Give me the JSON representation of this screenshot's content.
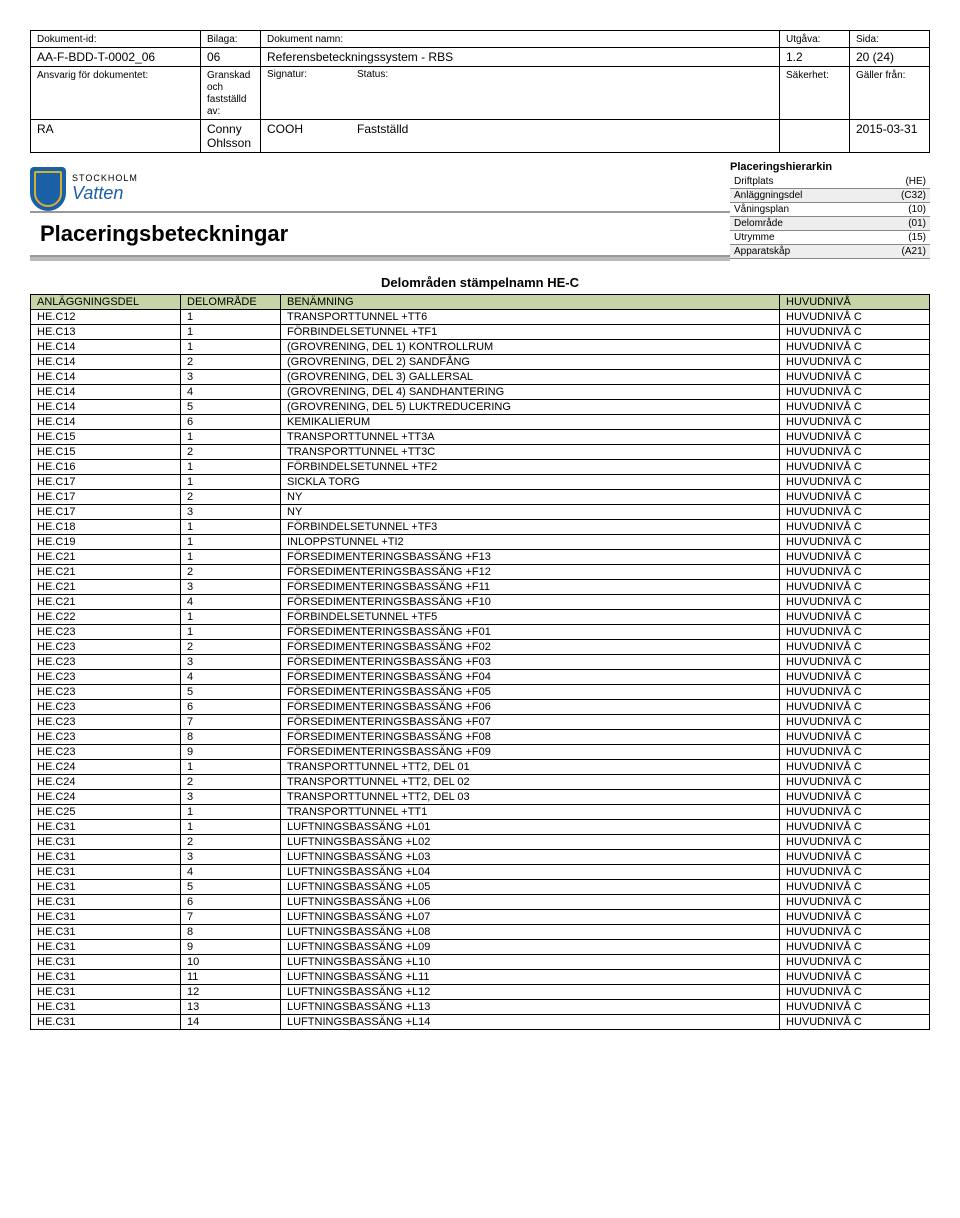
{
  "meta": {
    "labels": {
      "dok_id": "Dokument-id:",
      "bilaga": "Bilaga:",
      "dok_namn": "Dokument namn:",
      "utgava": "Utgåva:",
      "sida": "Sida:",
      "ansvarig": "Ansvarig för dokumentet:",
      "granskad": "Granskad och fastställd av:",
      "signatur": "Signatur:",
      "status": "Status:",
      "sakerhet": "Säkerhet:",
      "galler": "Gäller från:"
    },
    "values": {
      "dok_id": "AA-F-BDD-T-0002_06",
      "bilaga": "06",
      "dok_namn": "Referensbeteckningssystem - RBS",
      "utgava": "1.2",
      "sida": "20 (24)",
      "ansvarig": "RA",
      "granskad": "Conny Ohlsson",
      "signatur": "COOH",
      "status": "Fastställd",
      "sakerhet": "",
      "galler": "2015-03-31"
    }
  },
  "logo": {
    "line1": "STOCKHOLM",
    "line2": "Vatten"
  },
  "page_title": "Placeringsbeteckningar",
  "hierarchy": {
    "title": "Placeringshierarkin",
    "rows": [
      {
        "label": "Driftplats",
        "code": "(HE)"
      },
      {
        "label": "Anläggningsdel",
        "code": "(C32)"
      },
      {
        "label": "Våningsplan",
        "code": "(10)"
      },
      {
        "label": "Delområde",
        "code": "(01)"
      },
      {
        "label": "Utrymme",
        "code": "(15)"
      },
      {
        "label": "Apparatskåp",
        "code": "(A21)"
      }
    ]
  },
  "section_title": "Delområden stämpelnamn HE-C",
  "table": {
    "headers": {
      "a": "ANLÄGGNINGSDEL",
      "b": "DELOMRÅDE",
      "c": "BENÄMNING",
      "d": "HUVUDNIVÅ"
    },
    "rows": [
      {
        "a": "HE.C12",
        "b": "1",
        "c": "TRANSPORTTUNNEL +TT6",
        "d": "HUVUDNIVÅ C"
      },
      {
        "a": "HE.C13",
        "b": "1",
        "c": "FÖRBINDELSETUNNEL +TF1",
        "d": "HUVUDNIVÅ C"
      },
      {
        "a": "HE.C14",
        "b": "1",
        "c": "(GROVRENING, DEL 1) KONTROLLRUM",
        "d": "HUVUDNIVÅ C"
      },
      {
        "a": "HE.C14",
        "b": "2",
        "c": "(GROVRENING, DEL 2) SANDFÅNG",
        "d": "HUVUDNIVÅ C"
      },
      {
        "a": "HE.C14",
        "b": "3",
        "c": "(GROVRENING, DEL 3) GALLERSAL",
        "d": "HUVUDNIVÅ C"
      },
      {
        "a": "HE.C14",
        "b": "4",
        "c": "(GROVRENING, DEL 4) SANDHANTERING",
        "d": "HUVUDNIVÅ C"
      },
      {
        "a": "HE.C14",
        "b": "5",
        "c": "(GROVRENING, DEL 5) LUKTREDUCERING",
        "d": "HUVUDNIVÅ C"
      },
      {
        "a": "HE.C14",
        "b": "6",
        "c": "KEMIKALIERUM",
        "d": "HUVUDNIVÅ C"
      },
      {
        "a": "HE.C15",
        "b": "1",
        "c": "TRANSPORTTUNNEL +TT3A",
        "d": "HUVUDNIVÅ C"
      },
      {
        "a": "HE.C15",
        "b": "2",
        "c": "TRANSPORTTUNNEL +TT3C",
        "d": "HUVUDNIVÅ C"
      },
      {
        "a": "HE.C16",
        "b": "1",
        "c": "FÖRBINDELSETUNNEL +TF2",
        "d": "HUVUDNIVÅ C"
      },
      {
        "a": "HE.C17",
        "b": "1",
        "c": "SICKLA TORG",
        "d": "HUVUDNIVÅ C"
      },
      {
        "a": "HE.C17",
        "b": "2",
        "c": "NY",
        "d": "HUVUDNIVÅ C"
      },
      {
        "a": "HE.C17",
        "b": "3",
        "c": "NY",
        "d": "HUVUDNIVÅ C"
      },
      {
        "a": "HE.C18",
        "b": "1",
        "c": "FÖRBINDELSETUNNEL +TF3",
        "d": "HUVUDNIVÅ C"
      },
      {
        "a": "HE.C19",
        "b": "1",
        "c": "INLOPPSTUNNEL +TI2",
        "d": "HUVUDNIVÅ C"
      },
      {
        "a": "HE.C21",
        "b": "1",
        "c": "FÖRSEDIMENTERINGSBASSÄNG +F13",
        "d": "HUVUDNIVÅ C"
      },
      {
        "a": "HE.C21",
        "b": "2",
        "c": "FÖRSEDIMENTERINGSBASSÄNG +F12",
        "d": "HUVUDNIVÅ C"
      },
      {
        "a": "HE.C21",
        "b": "3",
        "c": "FÖRSEDIMENTERINGSBASSÄNG +F11",
        "d": "HUVUDNIVÅ C"
      },
      {
        "a": "HE.C21",
        "b": "4",
        "c": "FÖRSEDIMENTERINGSBASSÄNG +F10",
        "d": "HUVUDNIVÅ C"
      },
      {
        "a": "HE.C22",
        "b": "1",
        "c": "FÖRBINDELSETUNNEL +TF5",
        "d": "HUVUDNIVÅ C"
      },
      {
        "a": "HE.C23",
        "b": "1",
        "c": "FÖRSEDIMENTERINGSBASSÄNG +F01",
        "d": "HUVUDNIVÅ C"
      },
      {
        "a": "HE.C23",
        "b": "2",
        "c": "FÖRSEDIMENTERINGSBASSÄNG +F02",
        "d": "HUVUDNIVÅ C"
      },
      {
        "a": "HE.C23",
        "b": "3",
        "c": "FÖRSEDIMENTERINGSBASSÄNG +F03",
        "d": "HUVUDNIVÅ C"
      },
      {
        "a": "HE.C23",
        "b": "4",
        "c": "FÖRSEDIMENTERINGSBASSÄNG +F04",
        "d": "HUVUDNIVÅ C"
      },
      {
        "a": "HE.C23",
        "b": "5",
        "c": "FÖRSEDIMENTERINGSBASSÄNG +F05",
        "d": "HUVUDNIVÅ C"
      },
      {
        "a": "HE.C23",
        "b": "6",
        "c": "FÖRSEDIMENTERINGSBASSÄNG +F06",
        "d": "HUVUDNIVÅ C"
      },
      {
        "a": "HE.C23",
        "b": "7",
        "c": "FÖRSEDIMENTERINGSBASSÄNG +F07",
        "d": "HUVUDNIVÅ C"
      },
      {
        "a": "HE.C23",
        "b": "8",
        "c": "FÖRSEDIMENTERINGSBASSÄNG +F08",
        "d": "HUVUDNIVÅ C"
      },
      {
        "a": "HE.C23",
        "b": "9",
        "c": "FÖRSEDIMENTERINGSBASSÄNG +F09",
        "d": "HUVUDNIVÅ C"
      },
      {
        "a": "HE.C24",
        "b": "1",
        "c": "TRANSPORTTUNNEL +TT2, DEL 01",
        "d": "HUVUDNIVÅ C"
      },
      {
        "a": "HE.C24",
        "b": "2",
        "c": "TRANSPORTTUNNEL +TT2, DEL 02",
        "d": "HUVUDNIVÅ C"
      },
      {
        "a": "HE.C24",
        "b": "3",
        "c": "TRANSPORTTUNNEL +TT2, DEL 03",
        "d": "HUVUDNIVÅ C"
      },
      {
        "a": "HE.C25",
        "b": "1",
        "c": "TRANSPORTTUNNEL +TT1",
        "d": "HUVUDNIVÅ C"
      },
      {
        "a": "HE.C31",
        "b": "1",
        "c": "LUFTNINGSBASSÄNG +L01",
        "d": "HUVUDNIVÅ C"
      },
      {
        "a": "HE.C31",
        "b": "2",
        "c": "LUFTNINGSBASSÄNG +L02",
        "d": "HUVUDNIVÅ C"
      },
      {
        "a": "HE.C31",
        "b": "3",
        "c": "LUFTNINGSBASSÄNG +L03",
        "d": "HUVUDNIVÅ C"
      },
      {
        "a": "HE.C31",
        "b": "4",
        "c": "LUFTNINGSBASSÄNG +L04",
        "d": "HUVUDNIVÅ C"
      },
      {
        "a": "HE.C31",
        "b": "5",
        "c": "LUFTNINGSBASSÄNG +L05",
        "d": "HUVUDNIVÅ C"
      },
      {
        "a": "HE.C31",
        "b": "6",
        "c": "LUFTNINGSBASSÄNG +L06",
        "d": "HUVUDNIVÅ C"
      },
      {
        "a": "HE.C31",
        "b": "7",
        "c": "LUFTNINGSBASSÄNG +L07",
        "d": "HUVUDNIVÅ C"
      },
      {
        "a": "HE.C31",
        "b": "8",
        "c": "LUFTNINGSBASSÄNG +L08",
        "d": "HUVUDNIVÅ C"
      },
      {
        "a": "HE.C31",
        "b": "9",
        "c": "LUFTNINGSBASSÄNG +L09",
        "d": "HUVUDNIVÅ C"
      },
      {
        "a": "HE.C31",
        "b": "10",
        "c": "LUFTNINGSBASSÄNG +L10",
        "d": "HUVUDNIVÅ C"
      },
      {
        "a": "HE.C31",
        "b": "11",
        "c": "LUFTNINGSBASSÄNG +L11",
        "d": "HUVUDNIVÅ C"
      },
      {
        "a": "HE.C31",
        "b": "12",
        "c": "LUFTNINGSBASSÄNG +L12",
        "d": "HUVUDNIVÅ C"
      },
      {
        "a": "HE.C31",
        "b": "13",
        "c": "LUFTNINGSBASSÄNG +L13",
        "d": "HUVUDNIVÅ C"
      },
      {
        "a": "HE.C31",
        "b": "14",
        "c": "LUFTNINGSBASSÄNG +L14",
        "d": "HUVUDNIVÅ C"
      }
    ]
  }
}
